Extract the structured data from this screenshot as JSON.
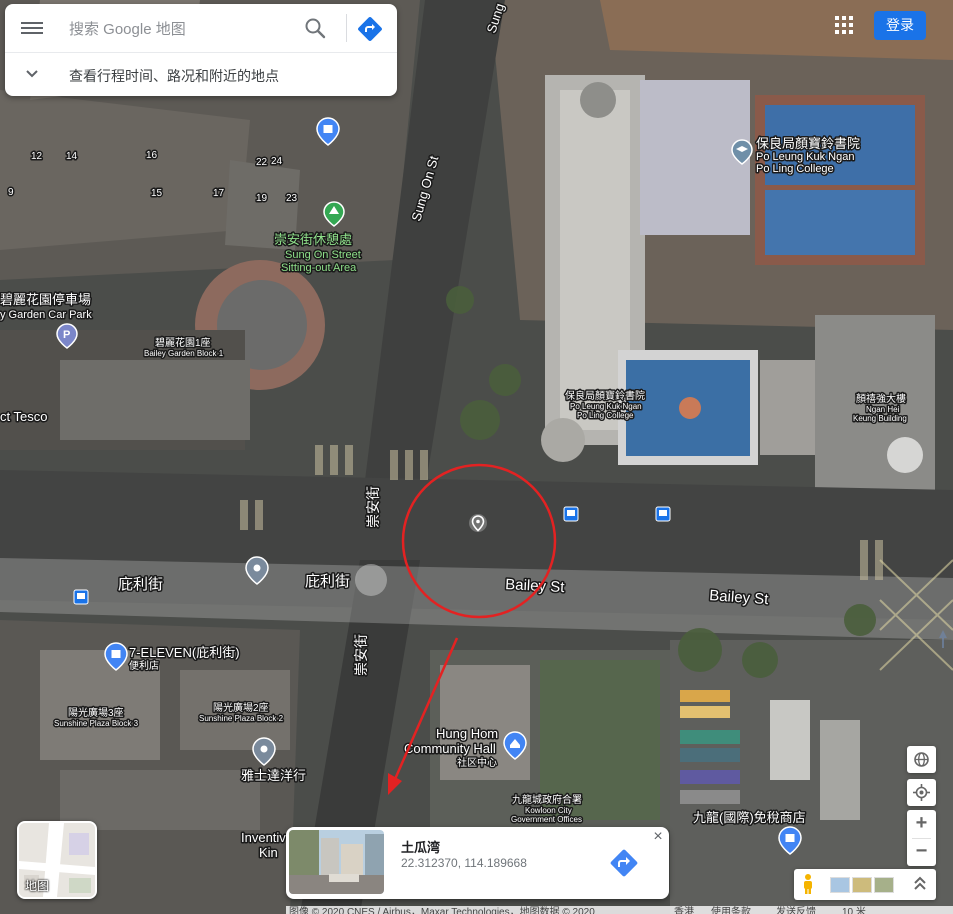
{
  "search": {
    "placeholder": "搜索 Google 地图",
    "expand_label": "查看行程时间、路况和附近的地点"
  },
  "top_right": {
    "signin_label": "登录"
  },
  "map_labels": {
    "sung_on_st_top": "Sung",
    "sung_on_st": "Sung On St",
    "house_12": "12",
    "house_14": "14",
    "house_16": "16",
    "house_22": "22",
    "house_24": "24",
    "house_9": "9",
    "house_15": "15",
    "house_17": "17",
    "house_19": "19",
    "house_23": "23",
    "park_cn": "崇安街休憩處",
    "park_en_1": "Sung On Street",
    "park_en_2": "Sitting-out Area",
    "carpark_cn": "碧麗花園停車場",
    "carpark_en": "y Garden Car Park",
    "bailey_block1_cn": "碧麗花園1座",
    "bailey_block1_en": "Bailey Garden Block 1",
    "tesco": "ct Tesco",
    "school_cn": "保良局顏寶鈴書院",
    "school_en_1": "Po Leung Kuk Ngan",
    "school_en_2": "Po Ling College",
    "school_small_cn": "保良局顏寶鈴書院",
    "school_small_en_1": "Po Leung Kuk Ngan",
    "school_small_en_2": "Po Ling College",
    "ngan_hei_cn": "顏禧強大樓",
    "ngan_hei_en_1": "Ngan Hei",
    "ngan_hei_en_2": "Keung Building",
    "sung_on_cn_upper": "崇安街",
    "sung_on_cn_lower": "崇安街",
    "bailey_cn_left": "庇利街",
    "bailey_cn_mid": "庇利街",
    "bailey_en_mid": "Bailey St",
    "bailey_en_right": "Bailey St",
    "seven_eleven": "7-ELEVEN(庇利街)",
    "seven_eleven_sub": "便利店",
    "sunshine3_cn": "陽光廣場3座",
    "sunshine3_en": "Sunshine Plaza Block 3",
    "sunshine2_cn": "陽光廣場2座",
    "sunshine2_en": "Sunshine Plaza Block 2",
    "yashi": "雅士達洋行",
    "inventive_1": "Inventiv",
    "inventive_2": "Kin",
    "hunghom_1": "Hung Hom",
    "hunghom_2": "Community Hall",
    "hunghom_cn": "社区中心",
    "kowloon_gov_cn": "九龍城政府合署",
    "kowloon_gov_en_1": "Kowloon City",
    "kowloon_gov_en_2": "Government Offices",
    "dutyfree": "九龍(國際)免稅商店"
  },
  "layers": {
    "label": "地图"
  },
  "info_card": {
    "title": "土瓜湾",
    "coords": "22.312370, 114.189668"
  },
  "footer": {
    "imagery": "图像 © 2020 CNES / Airbus，Maxar Technologies，地图数据 © 2020",
    "region": "香港",
    "terms": "使用条款",
    "feedback": "发送反馈",
    "scale": "10 米"
  },
  "colors": {
    "accent": "#1a73e8",
    "annotation_red": "#e32222",
    "directions_blue": "#4285f4",
    "park_green": "#34a853"
  },
  "icons": {
    "menu": "menu-icon",
    "search": "search-icon",
    "directions": "directions-icon",
    "expand": "chevron-down-icon",
    "apps": "apps-grid-icon",
    "globe": "globe-icon",
    "location": "my-location-icon",
    "pegman": "pegman-icon",
    "close": "close-icon"
  }
}
